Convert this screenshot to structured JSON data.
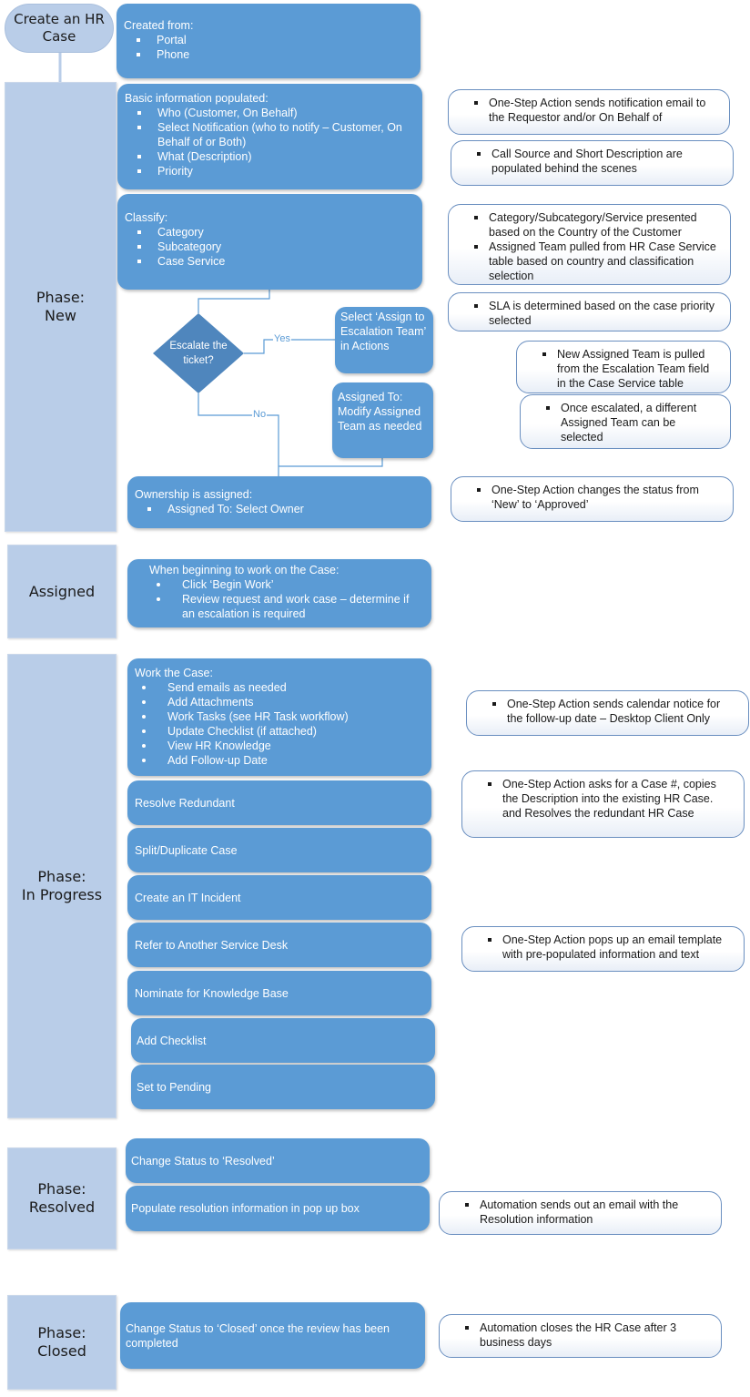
{
  "start": {
    "label": "Create an HR Case"
  },
  "created_from": {
    "title": "Created from:",
    "items": [
      "Portal",
      "Phone"
    ]
  },
  "phases": {
    "new": "Phase:\nNew",
    "assigned": "Assigned",
    "in_progress": "Phase:\nIn Progress",
    "resolved": "Phase:\nResolved",
    "closed": "Phase:\nClosed"
  },
  "new_phase": {
    "basic_info": {
      "title": "Basic information populated:",
      "items": [
        "Who (Customer, On Behalf)",
        "Select Notification (who to notify – Customer, On Behalf of or Both)",
        "What (Description)",
        "Priority"
      ]
    },
    "classify": {
      "title": "Classify:",
      "items": [
        "Category",
        "Subcategory",
        "Case Service"
      ]
    },
    "decision": {
      "label": "Escalate the ticket?",
      "yes": "Yes",
      "no": "No"
    },
    "escalation_step": "Select ‘Assign to Escalation Team’ in Actions",
    "modify_step": "Assigned To: Modify Assigned Team as needed",
    "ownership": {
      "title": "Ownership is assigned:",
      "items": [
        "Assigned To: Select Owner"
      ]
    },
    "notes": [
      "One-Step Action sends notification email to the Requestor and/or On Behalf of",
      "Call Source and Short Description are populated behind the scenes",
      [
        "Category/Subcategory/Service presented based on the Country of the Customer",
        "Assigned Team pulled from HR Case Service table based on country and classification selection"
      ],
      "SLA is determined based on the case priority selected",
      "New Assigned Team is pulled from the Escalation Team field in the Case Service table",
      "Once escalated, a different Assigned Team can be selected",
      "One-Step Action changes the status from ‘New’ to ‘Approved’"
    ]
  },
  "assigned_phase": {
    "title": "When beginning to work on the Case:",
    "items": [
      "Click ‘Begin Work’",
      "Review request and work case – determine if an escalation is required"
    ]
  },
  "in_progress_phase": {
    "work": {
      "title": "Work the Case:",
      "items": [
        "Send emails as needed",
        "Add Attachments",
        "Work Tasks (see HR Task workflow)",
        "Update Checklist (if attached)",
        "View HR Knowledge",
        "Add Follow-up Date"
      ]
    },
    "steps": [
      "Resolve Redundant",
      "Split/Duplicate Case",
      "Create an IT Incident",
      "Refer to Another Service Desk",
      "Nominate for Knowledge Base",
      "Add Checklist",
      "Set to Pending"
    ],
    "notes": [
      "One-Step Action sends calendar notice for the follow-up date – Desktop Client Only",
      "One-Step Action asks for a Case #, copies the Description into the existing HR Case. and Resolves the redundant HR Case",
      "One-Step Action pops up an email template with pre-populated information and text"
    ]
  },
  "resolved_phase": {
    "steps": [
      "Change Status to ‘Resolved’",
      "Populate resolution information in pop up box"
    ],
    "note": "Automation sends out an email with the Resolution information"
  },
  "closed_phase": {
    "step": "Change Status to ‘Closed’ once the review has been completed",
    "note": "Automation closes the HR Case after 3 business days"
  },
  "colors": {
    "step_fill": "#5b9bd5",
    "phase_fill": "#b9cde8",
    "decision_fill": "#4f86bd",
    "connector": "#5b9bd5"
  }
}
